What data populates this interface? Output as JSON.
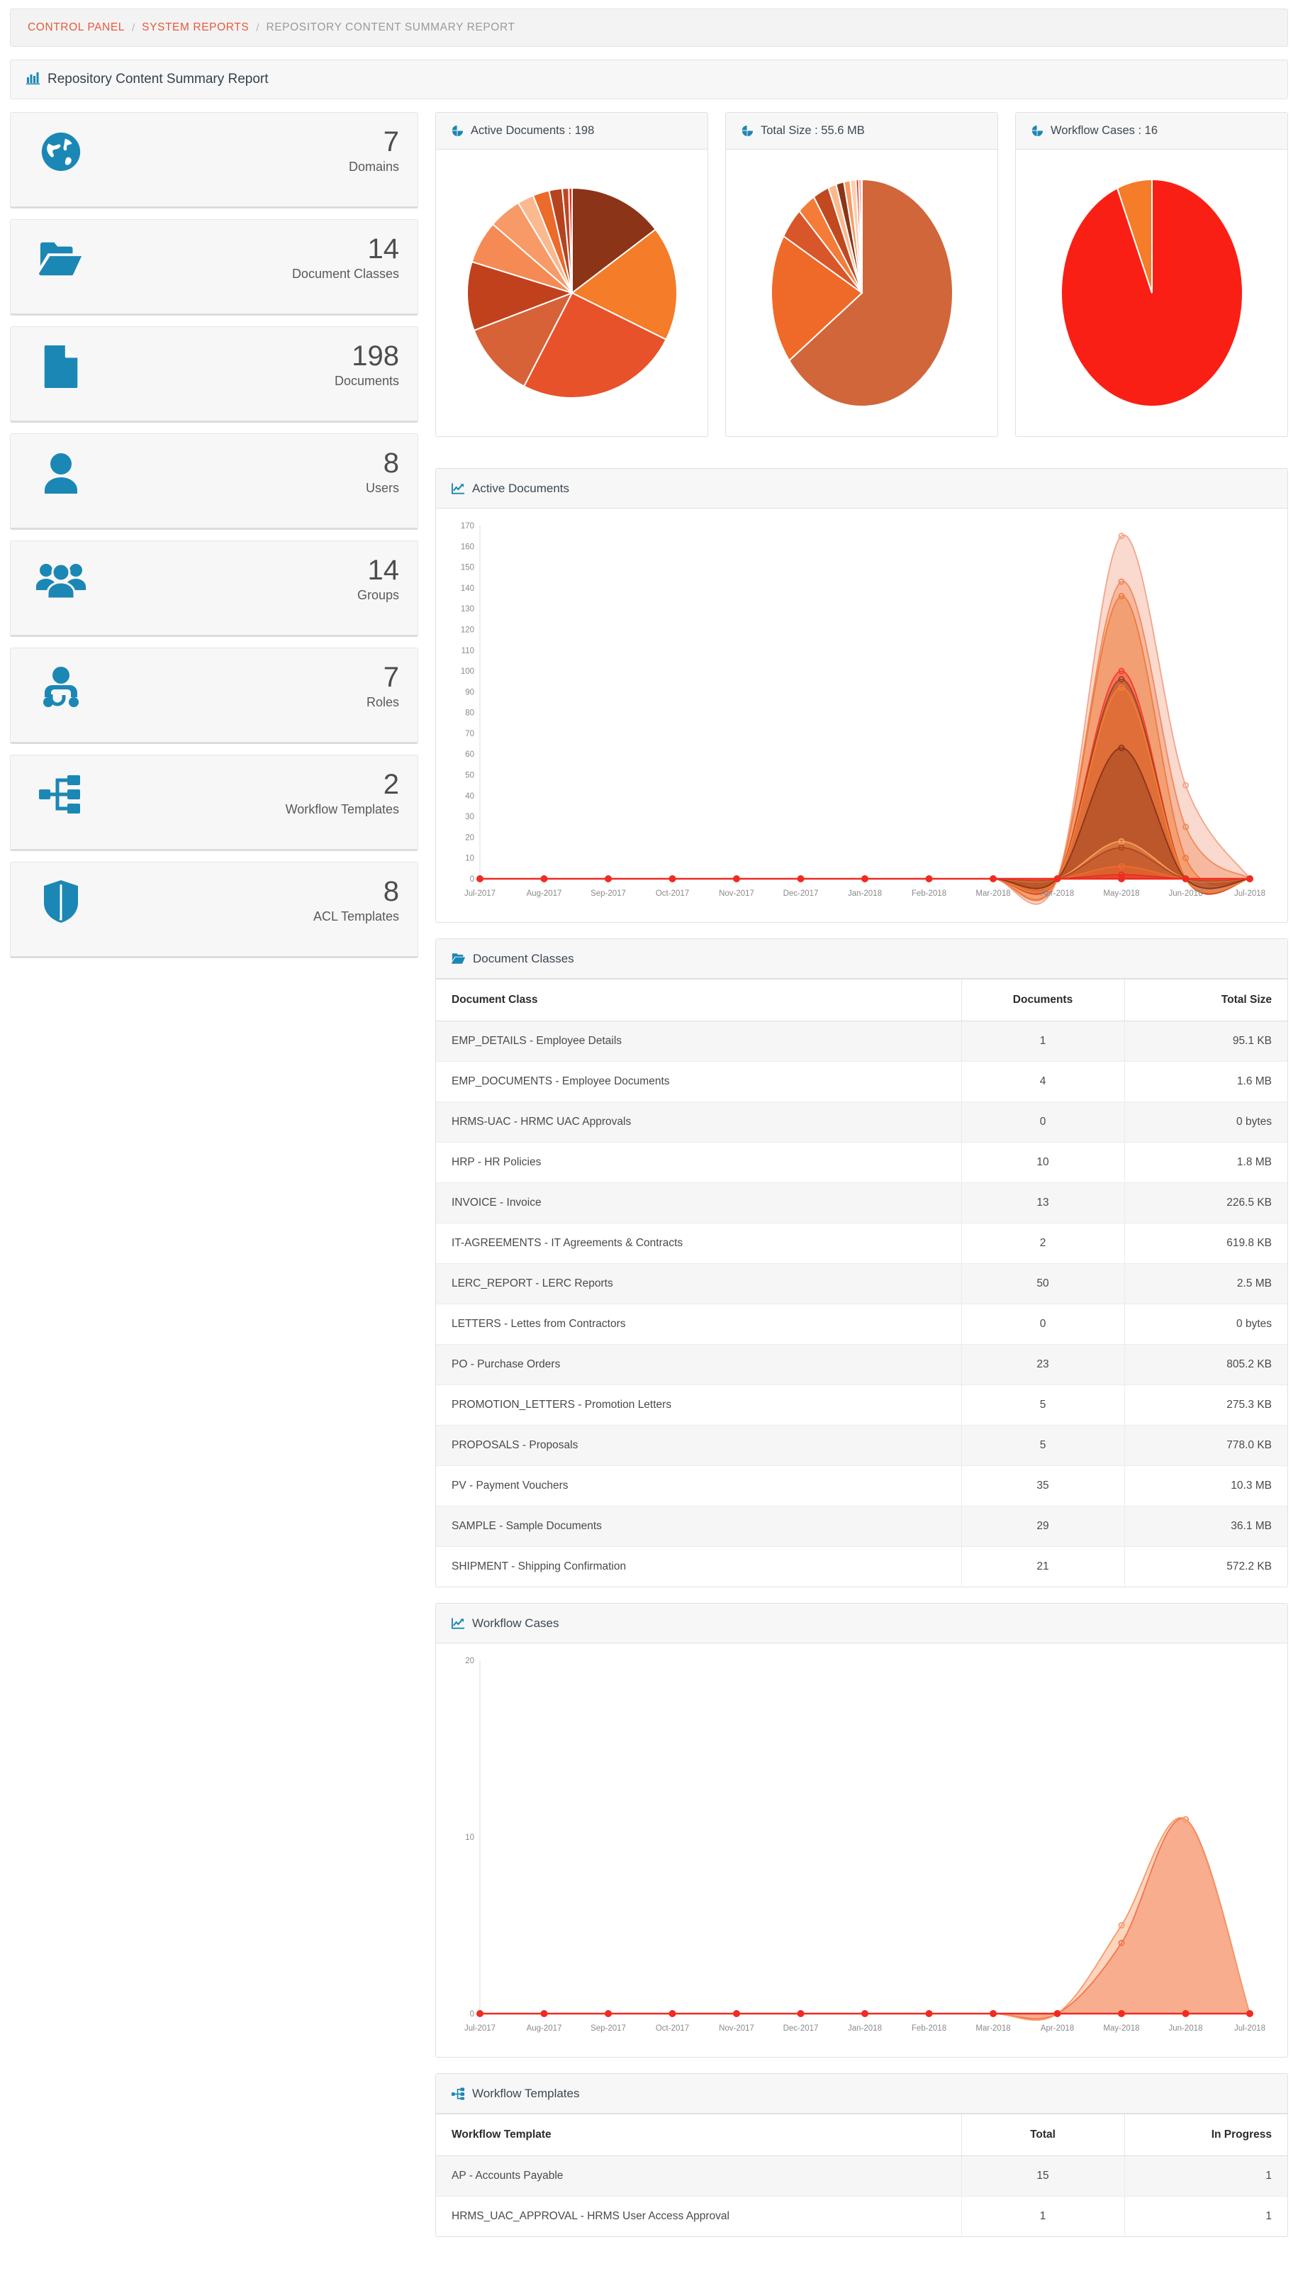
{
  "breadcrumb": {
    "items": [
      {
        "label": "CONTROL PANEL",
        "type": "link"
      },
      {
        "label": "SYSTEM REPORTS",
        "type": "link"
      },
      {
        "label": "REPOSITORY CONTENT SUMMARY REPORT",
        "type": "current"
      }
    ],
    "separator": "/"
  },
  "page": {
    "title": "Repository Content Summary Report",
    "icon": "bar-chart-icon"
  },
  "colors": {
    "link": "#e8593b",
    "icon_blue": "#1b87b5",
    "line_red": "#ef2b22",
    "panel_border": "#e1e1e1",
    "card_bg": "#f7f7f7"
  },
  "stats": {
    "cards": [
      {
        "icon": "globe-icon",
        "value": "7",
        "label": "Domains"
      },
      {
        "icon": "folder-open-icon",
        "value": "14",
        "label": "Document Classes"
      },
      {
        "icon": "document-icon",
        "value": "198",
        "label": "Documents"
      },
      {
        "icon": "user-icon",
        "value": "8",
        "label": "Users"
      },
      {
        "icon": "users-group-icon",
        "value": "14",
        "label": "Groups"
      },
      {
        "icon": "user-role-icon",
        "value": "7",
        "label": "Roles"
      },
      {
        "icon": "workflow-template-icon",
        "value": "2",
        "label": "Workflow Templates"
      },
      {
        "icon": "shield-icon",
        "value": "8",
        "label": "ACL Templates"
      }
    ]
  },
  "pies": [
    {
      "icon": "pie-chart-icon",
      "title": "Active Documents : 198"
    },
    {
      "icon": "pie-chart-icon",
      "title": "Total Size : 55.6 MB"
    },
    {
      "icon": "pie-chart-icon",
      "title": "Workflow Cases : 16"
    }
  ],
  "panels": {
    "active_documents": {
      "icon": "line-chart-icon",
      "title": "Active Documents"
    },
    "document_classes": {
      "icon": "folder-open-icon",
      "title": "Document Classes"
    },
    "workflow_cases": {
      "icon": "line-chart-icon",
      "title": "Workflow Cases"
    },
    "workflow_templates": {
      "icon": "workflow-template-icon",
      "title": "Workflow Templates"
    }
  },
  "document_classes_table": {
    "headers": [
      "Document Class",
      "Documents",
      "Total Size"
    ],
    "rows": [
      {
        "name": "EMP_DETAILS - Employee Details",
        "documents": "1",
        "size": "95.1 KB"
      },
      {
        "name": "EMP_DOCUMENTS - Employee Documents",
        "documents": "4",
        "size": "1.6 MB"
      },
      {
        "name": "HRMS-UAC - HRMC UAC Approvals",
        "documents": "0",
        "size": "0 bytes"
      },
      {
        "name": "HRP - HR Policies",
        "documents": "10",
        "size": "1.8 MB"
      },
      {
        "name": "INVOICE - Invoice",
        "documents": "13",
        "size": "226.5 KB"
      },
      {
        "name": "IT-AGREEMENTS - IT Agreements & Contracts",
        "documents": "2",
        "size": "619.8 KB"
      },
      {
        "name": "LERC_REPORT - LERC Reports",
        "documents": "50",
        "size": "2.5 MB"
      },
      {
        "name": "LETTERS - Lettes from Contractors",
        "documents": "0",
        "size": "0 bytes"
      },
      {
        "name": "PO - Purchase Orders",
        "documents": "23",
        "size": "805.2 KB"
      },
      {
        "name": "PROMOTION_LETTERS - Promotion Letters",
        "documents": "5",
        "size": "275.3 KB"
      },
      {
        "name": "PROPOSALS - Proposals",
        "documents": "5",
        "size": "778.0 KB"
      },
      {
        "name": "PV - Payment Vouchers",
        "documents": "35",
        "size": "10.3 MB"
      },
      {
        "name": "SAMPLE - Sample Documents",
        "documents": "29",
        "size": "36.1 MB"
      },
      {
        "name": "SHIPMENT - Shipping Confirmation",
        "documents": "21",
        "size": "572.2 KB"
      }
    ]
  },
  "workflow_templates_table": {
    "headers": [
      "Workflow Template",
      "Total",
      "In Progress"
    ],
    "rows": [
      {
        "name": "AP - Accounts Payable",
        "total": "15",
        "in_progress": "1"
      },
      {
        "name": "HRMS_UAC_APPROVAL - HRMS User Access Approval",
        "total": "1",
        "in_progress": "1"
      }
    ]
  },
  "chart_data": [
    {
      "type": "pie",
      "title": "Active Documents : 198",
      "labels": [
        "SAMPLE - Sample Documents",
        "PV - Payment Vouchers",
        "LERC_REPORT - LERC Reports",
        "PO - Purchase Orders",
        "SHIPMENT - Shipping Confirmation",
        "INVOICE - Invoice",
        "HRP - HR Policies",
        "PROPOSALS - Proposals",
        "PROMOTION_LETTERS - Promotion Letters",
        "EMP_DOCUMENTS - Employee Documents",
        "IT-AGREEMENTS - IT Agreements & Contracts",
        "EMP_DETAILS - Employee Details",
        "HRMS-UAC - HRMC UAC Approvals",
        "LETTERS - Lettes from Contractors"
      ],
      "values": [
        29,
        35,
        50,
        23,
        21,
        13,
        10,
        5,
        5,
        4,
        2,
        1,
        0,
        0
      ],
      "colors": [
        "#8c3418",
        "#f57c28",
        "#e8522a",
        "#d86238",
        "#c0411c",
        "#f68a54",
        "#f79a67",
        "#fbb98f",
        "#ec6a2a",
        "#b5431f",
        "#c24521",
        "#ef2b22",
        "#fdd0ae",
        "#a83b1a"
      ],
      "legend": "none"
    },
    {
      "type": "pie",
      "title": "Total Size : 55.6 MB",
      "labels": [
        "SAMPLE - Sample Documents",
        "PV - Payment Vouchers",
        "LERC_REPORT - LERC Reports",
        "HRP - HR Policies",
        "EMP_DOCUMENTS - Employee Documents",
        "PO - Purchase Orders",
        "PROPOSALS - Proposals",
        "IT-AGREEMENTS - IT Agreements & Contracts",
        "SHIPMENT - Shipping Confirmation",
        "PROMOTION_LETTERS - Promotion Letters",
        "INVOICE - Invoice",
        "EMP_DETAILS - Employee Details",
        "HRMS-UAC - HRMC UAC Approvals",
        "LETTERS - Lettes from Contractors"
      ],
      "values": [
        36.1,
        10.3,
        2.5,
        1.8,
        1.6,
        0.805,
        0.778,
        0.6198,
        0.5722,
        0.2753,
        0.2265,
        0.0951,
        0,
        0
      ],
      "units": "MB",
      "colors": [
        "#d0663a",
        "#ef6a28",
        "#d8562a",
        "#f47b38",
        "#c2481f",
        "#fbb98f",
        "#8c3418",
        "#f79a67",
        "#fdd0ae",
        "#ef2b22",
        "#f6582c",
        "#e8522a",
        "#fdd0ae",
        "#a83b1a"
      ],
      "legend": "none"
    },
    {
      "type": "pie",
      "title": "Workflow Cases : 16",
      "labels": [
        "AP - Accounts Payable",
        "HRMS_UAC_APPROVAL - HRMS User Access Approval"
      ],
      "values": [
        15,
        1
      ],
      "colors": [
        "#fa1f14",
        "#f57c28"
      ],
      "legend": "none"
    },
    {
      "type": "area",
      "title": "Active Documents",
      "x": [
        "Jul-2017",
        "Aug-2017",
        "Sep-2017",
        "Oct-2017",
        "Nov-2017",
        "Dec-2017",
        "Jan-2018",
        "Feb-2018",
        "Mar-2018",
        "Apr-2018",
        "May-2018",
        "Jun-2018",
        "Jul-2018"
      ],
      "ylim": [
        0,
        170
      ],
      "yticks": [
        0,
        10,
        20,
        30,
        40,
        50,
        60,
        70,
        80,
        90,
        100,
        110,
        120,
        130,
        140,
        150,
        160,
        170
      ],
      "grid": false,
      "series": [
        {
          "name": "LERC_REPORT - LERC Reports",
          "color": "#f2a48a",
          "values": [
            0,
            0,
            0,
            0,
            0,
            0,
            0,
            0,
            0,
            0,
            165,
            45,
            0
          ]
        },
        {
          "name": "PV - Payment Vouchers",
          "color": "#f08a5c",
          "values": [
            0,
            0,
            0,
            0,
            0,
            0,
            0,
            0,
            0,
            0,
            143,
            25,
            0
          ]
        },
        {
          "name": "SAMPLE - Sample Documents",
          "color": "#ef7b3c",
          "values": [
            0,
            0,
            0,
            0,
            0,
            0,
            0,
            0,
            0,
            0,
            136,
            10,
            0
          ]
        },
        {
          "name": "PO - Purchase Orders",
          "color": "#fa3b2c",
          "values": [
            0,
            0,
            0,
            0,
            0,
            0,
            0,
            0,
            0,
            0,
            100,
            0,
            0
          ]
        },
        {
          "name": "SHIPMENT - Shipping Confirmation",
          "color": "#9b4426",
          "values": [
            0,
            0,
            0,
            0,
            0,
            0,
            0,
            0,
            0,
            0,
            96,
            0,
            0
          ]
        },
        {
          "name": "INVOICE - Invoice",
          "color": "#f4802f",
          "values": [
            0,
            0,
            0,
            0,
            0,
            0,
            0,
            0,
            0,
            0,
            92,
            0,
            0
          ]
        },
        {
          "name": "HRP - HR Policies",
          "color": "#8c3418",
          "values": [
            0,
            0,
            0,
            0,
            0,
            0,
            0,
            0,
            0,
            0,
            63,
            0,
            0
          ]
        },
        {
          "name": "PROPOSALS - Proposals",
          "color": "#f9a05a",
          "values": [
            0,
            0,
            0,
            0,
            0,
            0,
            0,
            0,
            0,
            0,
            18,
            0,
            0
          ]
        },
        {
          "name": "PROMOTION_LETTERS - Promotion Letters",
          "color": "#b5431f",
          "values": [
            0,
            0,
            0,
            0,
            0,
            0,
            0,
            0,
            0,
            0,
            15,
            0,
            0
          ]
        },
        {
          "name": "EMP_DOCUMENTS - Employee Documents",
          "color": "#f2692c",
          "values": [
            0,
            0,
            0,
            0,
            0,
            0,
            0,
            0,
            0,
            0,
            6,
            0,
            0
          ]
        },
        {
          "name": "EMP_DETAILS - Employee Details",
          "color": "#ef2b22",
          "values": [
            0,
            0,
            0,
            0,
            0,
            0,
            0,
            0,
            0,
            0,
            2,
            0,
            0
          ]
        }
      ]
    },
    {
      "type": "area",
      "title": "Workflow Cases",
      "x": [
        "Jul-2017",
        "Aug-2017",
        "Sep-2017",
        "Oct-2017",
        "Nov-2017",
        "Dec-2017",
        "Jan-2018",
        "Feb-2018",
        "Mar-2018",
        "Apr-2018",
        "May-2018",
        "Jun-2018",
        "Jul-2018"
      ],
      "ylim": [
        0,
        20
      ],
      "yticks": [
        0,
        10,
        20
      ],
      "grid": false,
      "series": [
        {
          "name": "AP - Accounts Payable",
          "color": "#f05a3c",
          "values": [
            0,
            0,
            0,
            0,
            0,
            0,
            0,
            0,
            0,
            0,
            4,
            11,
            0
          ]
        },
        {
          "name": "HRMS_UAC_APPROVAL - HRMS User Access Approval",
          "color": "#f79a67",
          "values": [
            0,
            0,
            0,
            0,
            0,
            0,
            0,
            0,
            0,
            0,
            5,
            11,
            0
          ]
        }
      ]
    }
  ]
}
